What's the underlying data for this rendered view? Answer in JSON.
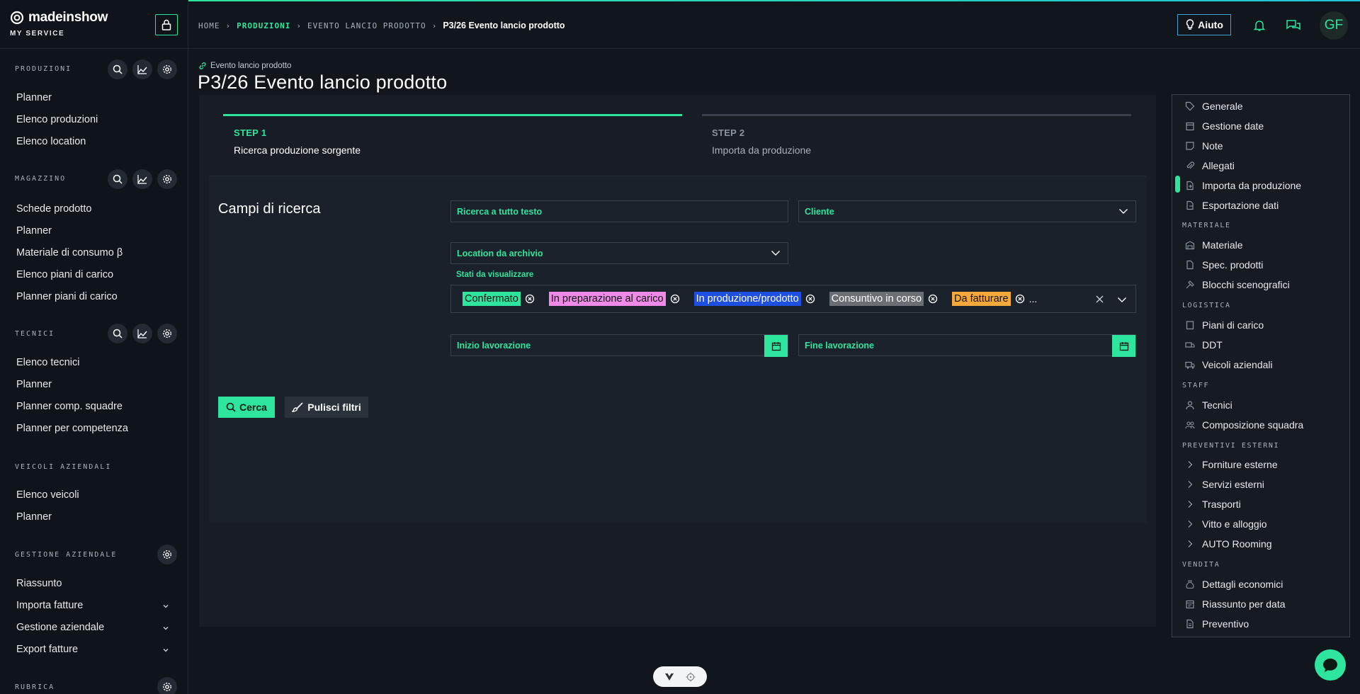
{
  "brand": {
    "name": "madeinshow",
    "subtitle": "MY SERVICE"
  },
  "sidebar": {
    "sections": [
      {
        "title": "PRODUZIONI",
        "items": [
          "Planner",
          "Elenco produzioni",
          "Elenco location"
        ]
      },
      {
        "title": "MAGAZZINO",
        "items": [
          "Schede prodotto",
          "Planner",
          "Materiale di consumo β",
          "Elenco piani di carico",
          "Planner piani di carico"
        ]
      },
      {
        "title": "TECNICI",
        "items": [
          "Elenco tecnici",
          "Planner",
          "Planner comp. squadre",
          "Planner per competenza"
        ]
      },
      {
        "title": "VEICOLI AZIENDALI",
        "items": [
          "Elenco veicoli",
          "Planner"
        ]
      },
      {
        "title": "GESTIONE AZIENDALE",
        "items": [
          "Riassunto",
          "Importa fatture",
          "Gestione aziendale",
          "Export fatture"
        ]
      },
      {
        "title": "RUBRICA",
        "items": []
      }
    ]
  },
  "breadcrumb": {
    "home": "HOME",
    "section": "PRODUZIONI",
    "event": "EVENTO LANCIO PRODOTTO",
    "current": "P3/26 Evento lancio prodotto"
  },
  "topbar": {
    "help_label": "Aiuto",
    "avatar_initials": "GF"
  },
  "page": {
    "eyebrow": "Evento lancio prodotto",
    "title": "P3/26 Evento lancio prodotto"
  },
  "steps": [
    {
      "label": "STEP 1",
      "desc": "Ricerca produzione sorgente"
    },
    {
      "label": "STEP 2",
      "desc": "Importa da produzione"
    }
  ],
  "search": {
    "title": "Campi di ricerca",
    "fulltext": "Ricerca a tutto testo",
    "cliente": "Cliente",
    "location": "Location da archivio",
    "stati_label": "Stati da visualizzare",
    "tags": [
      {
        "label": "Confermato",
        "color": "#2ee59d"
      },
      {
        "label": "In preparazione al carico",
        "color": "#f08ae8"
      },
      {
        "label": "In produzione/prodotto",
        "color": "#1f4fe0"
      },
      {
        "label": "Consuntivo in corso",
        "color": "#6b6f75"
      },
      {
        "label": "Da fatturare",
        "color": "#f5a93b"
      }
    ],
    "more": "...",
    "inizio": "Inizio lavorazione",
    "fine": "Fine lavorazione",
    "btn_search": "Cerca",
    "btn_clear": "Pulisci filtri"
  },
  "rmenu": {
    "top": [
      "Generale",
      "Gestione date",
      "Note",
      "Allegati",
      "Importa da produzione",
      "Esportazione dati"
    ],
    "materiale_head": "MATERIALE",
    "materiale": [
      "Materiale",
      "Spec. prodotti",
      "Blocchi scenografici"
    ],
    "logistica_head": "LOGISTICA",
    "logistica": [
      "Piani di carico",
      "DDT",
      "Veicoli aziendali"
    ],
    "staff_head": "STAFF",
    "staff": [
      "Tecnici",
      "Composizione squadra"
    ],
    "preventivi_head": "PREVENTIVI ESTERNI",
    "preventivi": [
      "Forniture esterne",
      "Servizi esterni",
      "Trasporti",
      "Vitto e alloggio",
      "AUTO Rooming"
    ],
    "vendita_head": "VENDITA",
    "vendita": [
      "Dettagli economici",
      "Riassunto per data",
      "Preventivo"
    ]
  },
  "colors": {
    "accent": "#2ee59d",
    "background": "#11161d",
    "panel": "#181d25"
  }
}
